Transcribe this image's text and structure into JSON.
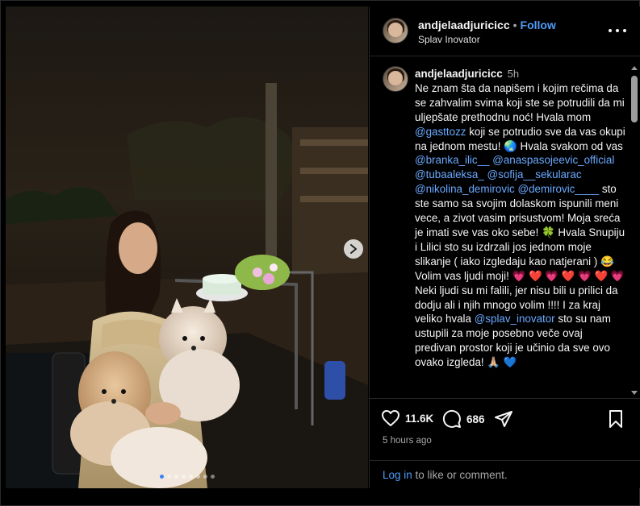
{
  "post": {
    "username": "andjelaadjuricicc",
    "separator": "•",
    "follow_label": "Follow",
    "location": "Splav Inovator"
  },
  "caption": {
    "username": "andjelaadjuricicc",
    "time": "5h",
    "segments": [
      {
        "type": "text",
        "value": "Ne znam šta da napišem i kojim rečima da se zahvalim svima koji ste se potrudili da mi uljepšate prethodnu noć! Hvala mom "
      },
      {
        "type": "mention",
        "value": "@gasttozz"
      },
      {
        "type": "text",
        "value": " koji se potrudio sve da vas okupi na jednom mestu! 🌏 Hvala svakom od vas "
      },
      {
        "type": "mention",
        "value": "@branka_ilic__"
      },
      {
        "type": "text",
        "value": " "
      },
      {
        "type": "mention",
        "value": "@anaspasojeevic_official"
      },
      {
        "type": "text",
        "value": " "
      },
      {
        "type": "mention",
        "value": "@tubaaleksa_"
      },
      {
        "type": "text",
        "value": " "
      },
      {
        "type": "mention",
        "value": "@sofija__sekularac"
      },
      {
        "type": "text",
        "value": " "
      },
      {
        "type": "mention",
        "value": "@nikolina_demirovic"
      },
      {
        "type": "text",
        "value": " "
      },
      {
        "type": "mention",
        "value": "@demirovic____"
      },
      {
        "type": "text",
        "value": " sto ste samo sa svojim dolaskom ispunili meni vece, a zivot vasim prisustvom! Moja sreća je imati sve vas oko sebe! 🍀 Hvala Snupiju i Lilici sto su izdrzali jos jednom moje slikanje ( iako izgledaju kao natjerani ) 😂 Volim vas ljudi moji! "
      },
      {
        "type": "heart",
        "value": "💗 ❤️ 💗 ❤️ 💗 ❤️ 💗"
      },
      {
        "type": "text",
        "value": " Neki ljudi su mi falili, jer nisu bili u prilici da dodju ali i njih mnogo volim !!!! I za kraj veliko hvala "
      },
      {
        "type": "mention",
        "value": "@splav_inovator"
      },
      {
        "type": "text",
        "value": " sto su nam ustupili za moje posebno veče ovaj predivan prostor koji je učinio da sve ovo ovako izgleda! 🙏🏼 💙"
      }
    ]
  },
  "actions": {
    "likes": "11.6K",
    "comments": "686"
  },
  "posted_ago": "5 hours ago",
  "login": {
    "link": "Log in",
    "rest": " to like or comment."
  },
  "carousel": {
    "total": 8,
    "active_index": 0,
    "active_color": "#3b82f6"
  },
  "colors": {
    "link": "#4f9cf9",
    "mention": "#6aa9ff",
    "background": "#000000"
  }
}
